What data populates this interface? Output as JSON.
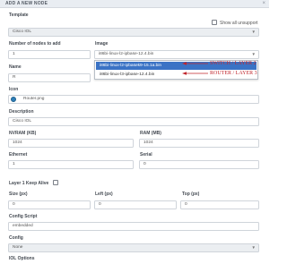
{
  "dialog": {
    "title": "ADD A NEW NODE",
    "close_glyph": "×"
  },
  "template": {
    "label": "Template",
    "value": "Cisco IOL"
  },
  "show_unsupported": {
    "label": "Show all unsupport"
  },
  "number_nodes": {
    "label": "Number of nodes to add",
    "value": "1"
  },
  "image": {
    "label": "Image",
    "value": "i86bi-linux-l2-ipbase-12.4.bin",
    "options": [
      "i86bi-linux-l2-ipbasek9-15.1a.bin",
      "i86bi-linux-l3-ipbase-12.4.bin"
    ]
  },
  "annotations": {
    "switch": "SWITCH / LAYER 2",
    "router": "ROUTER / LAYER 3"
  },
  "name": {
    "label": "Name",
    "value": "R"
  },
  "icon": {
    "label": "Icon",
    "value": "Router.png"
  },
  "description": {
    "label": "Description",
    "value": "Cisco IOL"
  },
  "nvram": {
    "label": "NVRAM (KB)",
    "value": "1024"
  },
  "ram": {
    "label": "RAM (MB)",
    "value": "1024"
  },
  "ethernet": {
    "label": "Ethernet",
    "value": "1"
  },
  "serial": {
    "label": "Serial",
    "value": "0"
  },
  "layer1": {
    "label": "Layer 1 Keep Alive"
  },
  "size": {
    "label": "Size (px)",
    "value": "0"
  },
  "left": {
    "label": "Left (px)",
    "value": "0"
  },
  "top": {
    "label": "Top (px)",
    "value": "0"
  },
  "config_script": {
    "label": "Config Script",
    "value": "embedded"
  },
  "config": {
    "label": "Config",
    "value": "None"
  },
  "iol_options": {
    "label": "IOL Options"
  },
  "colors": {
    "accent": "#3b73c5",
    "annotation": "#c0262d"
  }
}
